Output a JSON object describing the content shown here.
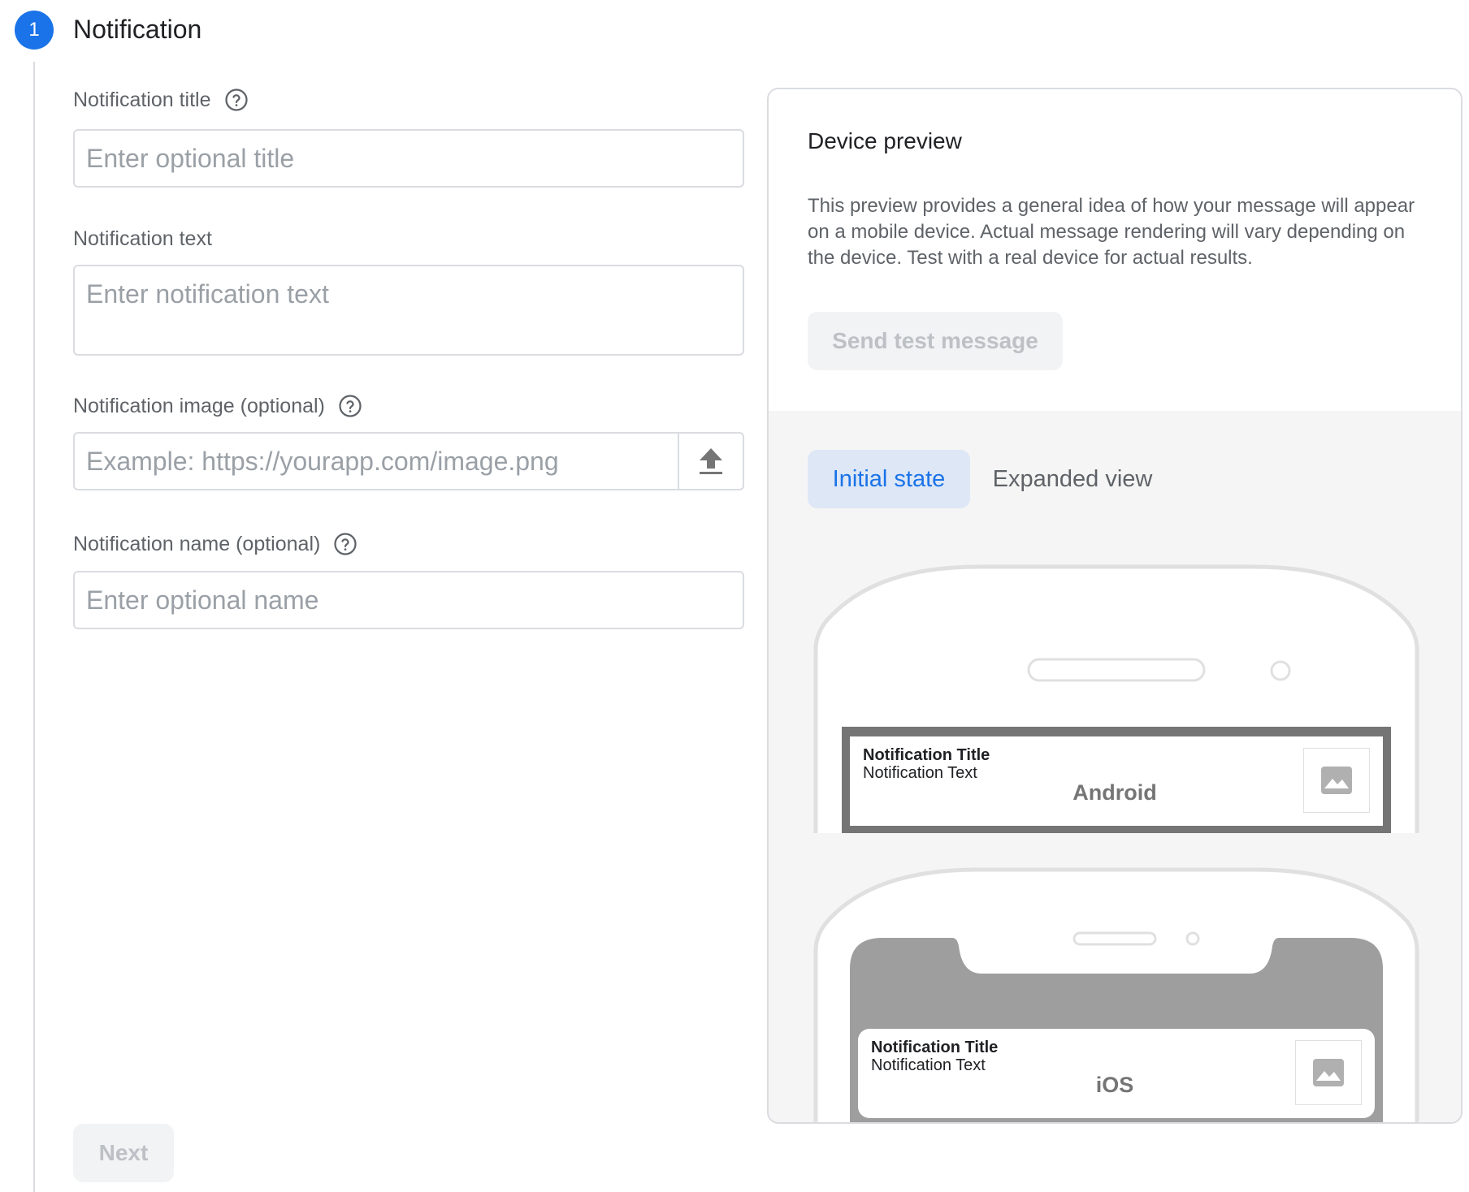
{
  "step": {
    "number": "1",
    "title": "Notification"
  },
  "form": {
    "title_label": "Notification title",
    "title_placeholder": "Enter optional title",
    "text_label": "Notification text",
    "text_placeholder": "Enter notification text",
    "image_label": "Notification image (optional)",
    "image_placeholder": "Example: https://yourapp.com/image.png",
    "name_label": "Notification name (optional)",
    "name_placeholder": "Enter optional name",
    "next_label": "Next"
  },
  "preview": {
    "heading": "Device preview",
    "description": "This preview provides a general idea of how your message will appear on a mobile device. Actual message rendering will vary depending on the device. Test with a real device for actual results.",
    "send_test_label": "Send test message",
    "tabs": [
      {
        "label": "Initial state",
        "active": true
      },
      {
        "label": "Expanded view",
        "active": false
      }
    ],
    "devices": [
      {
        "name": "Android",
        "notif_title": "Notification Title",
        "notif_text": "Notification Text"
      },
      {
        "name": "iOS",
        "notif_title": "Notification Title",
        "notif_text": "Notification Text"
      }
    ]
  },
  "colors": {
    "accent": "#1a73e8",
    "active_tab_bg": "#dde7f6",
    "disabled_button_bg": "#f1f3f4"
  },
  "icons": [
    "help-circle-icon",
    "upload-icon",
    "image-placeholder-icon"
  ]
}
